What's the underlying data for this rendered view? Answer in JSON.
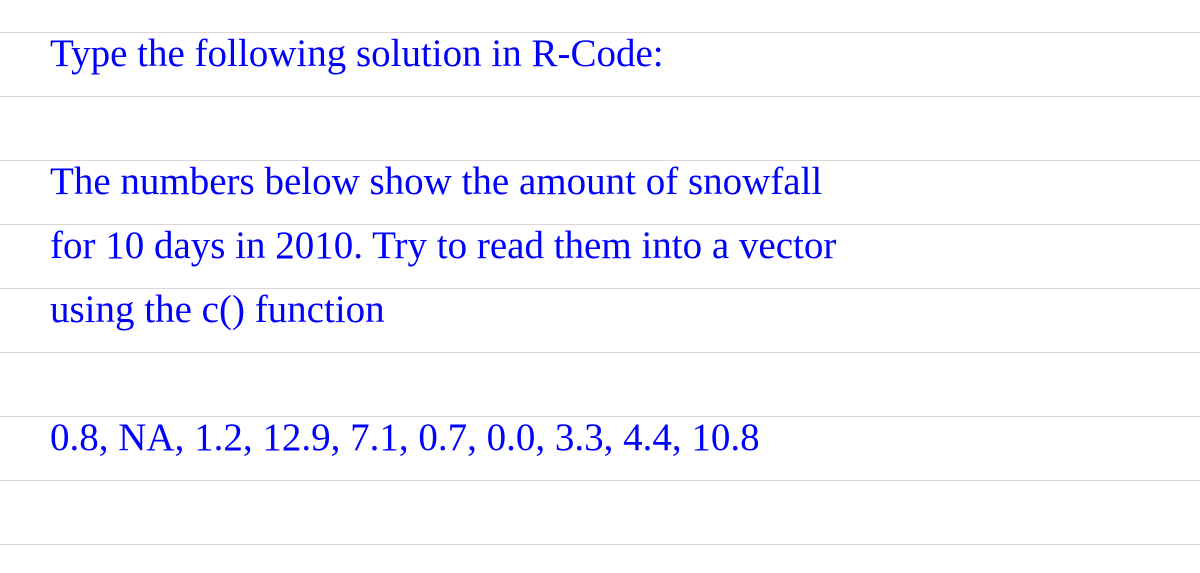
{
  "document": {
    "line1": "Type the following solution in R-Code:",
    "line2": "The numbers below show the amount of snowfall",
    "line3": "for 10 days in 2010. Try to read them into a vector",
    "line4": "using the c() function",
    "line5": "0.8, NA, 1.2, 12.9, 7.1, 0.7, 0.0, 3.3, 4.4, 10.8"
  }
}
